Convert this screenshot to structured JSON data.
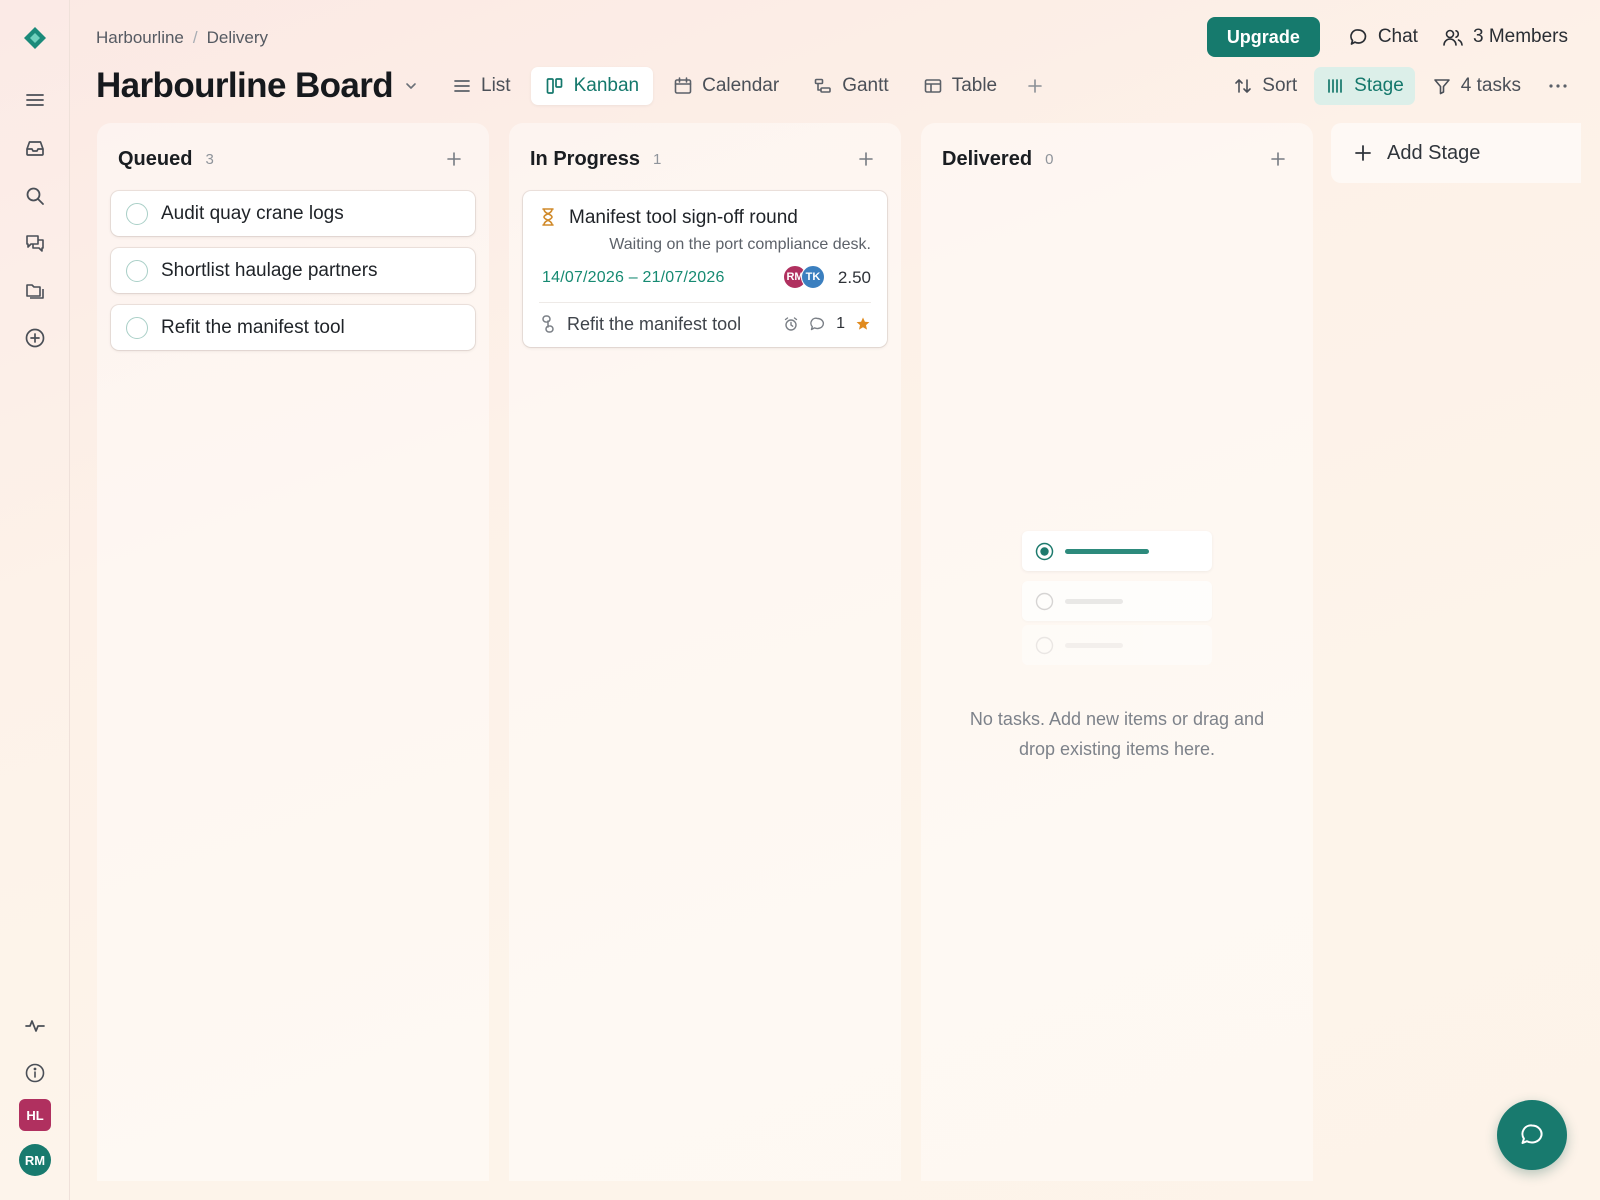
{
  "colors": {
    "accent": "#167a6d",
    "accent_soft": "#dcefe9",
    "date_green": "#168a72",
    "warning_orange": "#d08a2a",
    "workspace_avatar": "#b0305f",
    "user_avatar": "#187a6e"
  },
  "sidebar": {
    "logo_icon": "diamond-logo-icon",
    "items": [
      {
        "icon": "menu-icon"
      },
      {
        "icon": "inbox-icon"
      },
      {
        "icon": "search-icon"
      },
      {
        "icon": "chat-bubbles-icon"
      },
      {
        "icon": "folders-icon"
      },
      {
        "icon": "plus-circle-icon"
      }
    ],
    "bottom_items": [
      {
        "icon": "activity-icon"
      },
      {
        "icon": "info-icon"
      }
    ],
    "workspace_avatar": "HL",
    "user_avatar": "RM"
  },
  "breadcrumb": {
    "workspace": "Harbourline",
    "separator": "/",
    "project": "Delivery"
  },
  "board": {
    "title": "Harbourline Board"
  },
  "views": [
    {
      "label": "List",
      "icon": "list-icon",
      "active": false
    },
    {
      "label": "Kanban",
      "icon": "kanban-icon",
      "active": true
    },
    {
      "label": "Calendar",
      "icon": "calendar-icon",
      "active": false
    },
    {
      "label": "Gantt",
      "icon": "gantt-icon",
      "active": false
    },
    {
      "label": "Table",
      "icon": "table-icon",
      "active": false
    }
  ],
  "top_actions": {
    "upgrade": "Upgrade",
    "chat": "Chat",
    "members": "3 Members"
  },
  "toolbar": {
    "sort": "Sort",
    "group": "Stage",
    "filter": "4 tasks"
  },
  "columns": [
    {
      "title": "Queued",
      "count": "3",
      "cards": [
        {
          "title": "Audit quay crane logs"
        },
        {
          "title": "Shortlist haulage partners"
        },
        {
          "title": "Refit the manifest tool"
        }
      ]
    },
    {
      "title": "In Progress",
      "count": "1",
      "cards": [
        {
          "title": "Manifest tool sign-off round",
          "status_icon": "hourglass-icon",
          "description": "Waiting on the port compliance desk.",
          "dates": "14/07/2026 – 21/07/2026",
          "assignees": [
            {
              "initials": "RM",
              "color": "#b0305f"
            },
            {
              "initials": "TK",
              "color": "#3b7fbf"
            }
          ],
          "points": "2.50",
          "parent": "Refit the manifest tool",
          "comments": "1",
          "starred": true
        }
      ]
    },
    {
      "title": "Delivered",
      "count": "0",
      "cards": [],
      "empty_text": "No tasks. Add new items or drag and drop existing items here."
    }
  ],
  "add_stage": "Add Stage"
}
